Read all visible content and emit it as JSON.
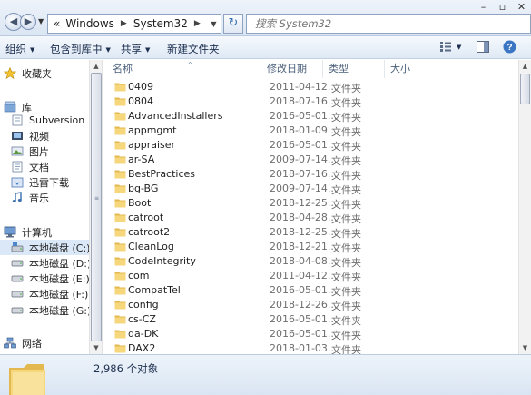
{
  "address": {
    "crumbs": [
      "Windows",
      "System32"
    ],
    "root_sep": "«"
  },
  "search": {
    "placeholder": "搜索 System32"
  },
  "toolbar": {
    "organize": "组织",
    "include_in_library": "包含到库中",
    "share": "共享",
    "new_folder": "新建文件夹"
  },
  "nav": {
    "favorites": "收藏夹",
    "library": "库",
    "library_items": [
      "Subversion",
      "视频",
      "图片",
      "文档",
      "迅雷下载",
      "音乐"
    ],
    "computer": "计算机",
    "drives": [
      "本地磁盘 (C:)",
      "本地磁盘 (D:)",
      "本地磁盘 (E:)",
      "本地磁盘 (F:)",
      "本地磁盘 (G:)"
    ],
    "network": "网络"
  },
  "columns": {
    "name": "名称",
    "date": "修改日期",
    "type": "类型",
    "size": "大小"
  },
  "files": [
    {
      "name": "0409",
      "date": "2011-04-12...",
      "type": "文件夹"
    },
    {
      "name": "0804",
      "date": "2018-07-16...",
      "type": "文件夹"
    },
    {
      "name": "AdvancedInstallers",
      "date": "2016-05-01...",
      "type": "文件夹"
    },
    {
      "name": "appmgmt",
      "date": "2018-01-09...",
      "type": "文件夹"
    },
    {
      "name": "appraiser",
      "date": "2016-05-01...",
      "type": "文件夹"
    },
    {
      "name": "ar-SA",
      "date": "2009-07-14...",
      "type": "文件夹"
    },
    {
      "name": "BestPractices",
      "date": "2018-07-16...",
      "type": "文件夹"
    },
    {
      "name": "bg-BG",
      "date": "2009-07-14...",
      "type": "文件夹"
    },
    {
      "name": "Boot",
      "date": "2018-12-25...",
      "type": "文件夹"
    },
    {
      "name": "catroot",
      "date": "2018-04-28...",
      "type": "文件夹"
    },
    {
      "name": "catroot2",
      "date": "2018-12-25...",
      "type": "文件夹"
    },
    {
      "name": "CleanLog",
      "date": "2018-12-21...",
      "type": "文件夹"
    },
    {
      "name": "CodeIntegrity",
      "date": "2018-04-08...",
      "type": "文件夹"
    },
    {
      "name": "com",
      "date": "2011-04-12...",
      "type": "文件夹"
    },
    {
      "name": "CompatTel",
      "date": "2016-05-01...",
      "type": "文件夹"
    },
    {
      "name": "config",
      "date": "2018-12-26...",
      "type": "文件夹"
    },
    {
      "name": "cs-CZ",
      "date": "2016-05-01...",
      "type": "文件夹"
    },
    {
      "name": "da-DK",
      "date": "2016-05-01...",
      "type": "文件夹"
    },
    {
      "name": "DAX2",
      "date": "2018-01-03...",
      "type": "文件夹"
    }
  ],
  "status": {
    "count": "2,986 个对象"
  },
  "colors": {
    "selection": "#dbe8f8",
    "folder": "#e8c35a",
    "chrome": "#dbe6f4"
  },
  "icons": {
    "back": "back-arrow-icon",
    "forward": "forward-arrow-icon",
    "refresh": "refresh-icon",
    "search": "search-icon",
    "folder": "folder-icon",
    "drive": "drive-icon",
    "view": "view-options-icon",
    "preview": "preview-pane-icon",
    "help": "help-icon"
  }
}
